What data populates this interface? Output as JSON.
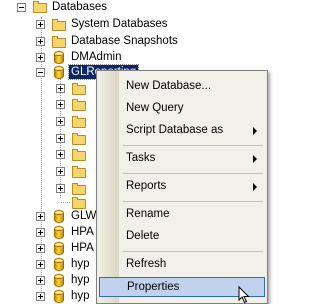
{
  "tree": {
    "root": {
      "label": "Databases"
    },
    "system_dbs": {
      "label": "System Databases"
    },
    "snapshots": {
      "label": "Database Snapshots"
    },
    "dmadmin": {
      "label": "DMAdmin"
    },
    "selected": {
      "label": "GLReporting"
    },
    "lower_dbs": [
      {
        "label": "GLW"
      },
      {
        "label": "HPA"
      },
      {
        "label": "HPA"
      },
      {
        "label": "hyp"
      },
      {
        "label": "hyp"
      },
      {
        "label": "hyp"
      }
    ]
  },
  "context_menu": {
    "new_database": "New Database...",
    "new_query": "New Query",
    "script_database_as": "Script Database as",
    "tasks": "Tasks",
    "reports": "Reports",
    "rename": "Rename",
    "delete": "Delete",
    "refresh": "Refresh",
    "properties": "Properties"
  },
  "colors": {
    "selection": "#0a246a",
    "menu_hover": "#c1d2ee",
    "menu_hover_border": "#316ac5"
  }
}
